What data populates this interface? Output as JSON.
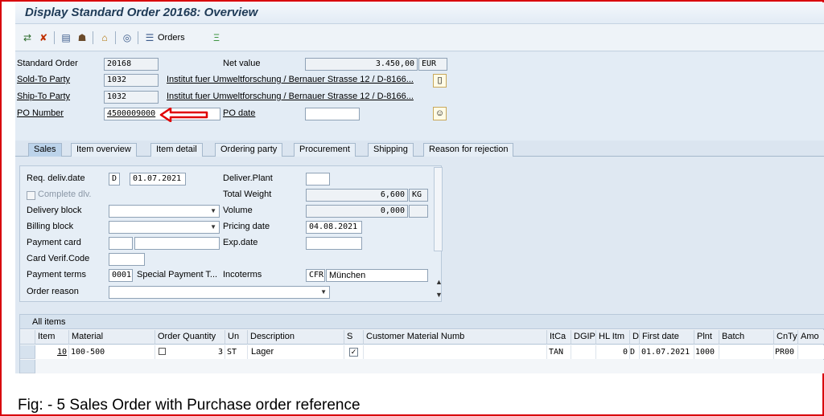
{
  "window": {
    "title": "Display Standard Order 20168: Overview"
  },
  "toolbar": {
    "orders_label": "Orders"
  },
  "header": {
    "standard_order_label": "Standard Order",
    "standard_order_value": "20168",
    "net_value_label": "Net value",
    "net_value": "3.450,00",
    "currency": "EUR",
    "sold_to_label": "Sold-To Party",
    "sold_to_value": "1032",
    "sold_to_address": "Institut fuer Umweltforschung / Bernauer Strasse 12 / D-8166...",
    "ship_to_label": "Ship-To Party",
    "ship_to_value": "1032",
    "ship_to_address": "Institut fuer Umweltforschung / Bernauer Strasse 12 / D-8166...",
    "po_number_label": "PO Number",
    "po_number_value": "4500009000",
    "po_date_label": "PO date",
    "po_date_value": ""
  },
  "tabs": [
    "Sales",
    "Item overview",
    "Item detail",
    "Ordering party",
    "Procurement",
    "Shipping",
    "Reason for rejection"
  ],
  "sales": {
    "req_deliv_label": "Req. deliv.date",
    "req_deliv_type": "D",
    "req_deliv_value": "01.07.2021",
    "deliver_plant_label": "Deliver.Plant",
    "complete_dlv_label": "Complete dlv.",
    "total_weight_label": "Total Weight",
    "total_weight_value": "6,600",
    "weight_unit": "KG",
    "delivery_block_label": "Delivery block",
    "volume_label": "Volume",
    "volume_value": "0,000",
    "billing_block_label": "Billing block",
    "pricing_date_label": "Pricing date",
    "pricing_date_value": "04.08.2021",
    "payment_card_label": "Payment card",
    "exp_date_label": "Exp.date",
    "card_verif_label": "Card Verif.Code",
    "payment_terms_label": "Payment terms",
    "payment_terms_code": "0001",
    "payment_terms_text": "Special Payment T...",
    "incoterms_label": "Incoterms",
    "incoterms_code": "CFR",
    "incoterms_place": "München",
    "order_reason_label": "Order reason"
  },
  "items": {
    "section_label": "All items",
    "columns": [
      "Item",
      "Material",
      "Order Quantity",
      "Un",
      "Description",
      "S",
      "Customer Material Numb",
      "ItCa",
      "DGIP",
      "HL Itm",
      "D",
      "First date",
      "Plnt",
      "Batch",
      "CnTy",
      "Amo"
    ],
    "rows": [
      {
        "item": "10",
        "material": "100-500",
        "qty": "3",
        "un": "ST",
        "description": "Lager",
        "s_checked": true,
        "ccmn": "",
        "itca": "TAN",
        "dgip": "",
        "hl_itm": "0",
        "d": "D",
        "first_date": "01.07.2021",
        "plnt": "1000",
        "batch": "",
        "cnty": "PR00"
      }
    ]
  },
  "caption": "Fig: - 5 Sales Order with Purchase order reference",
  "colors": {
    "annotation_red": "#e00000",
    "frame_red": "#d8000c"
  }
}
